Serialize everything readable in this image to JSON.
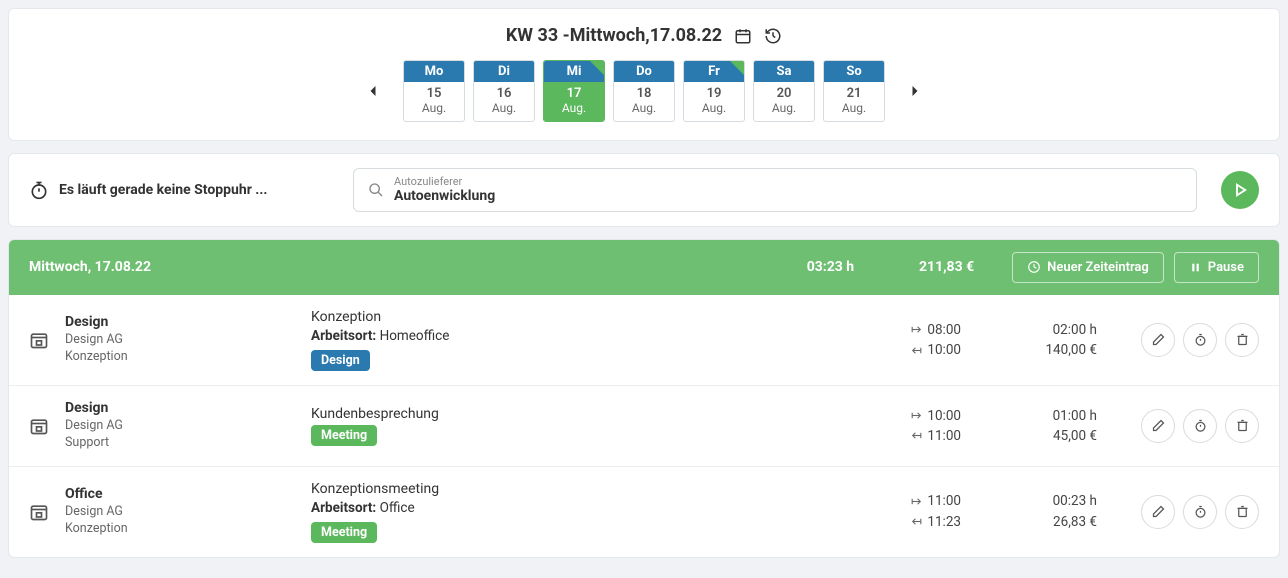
{
  "header": {
    "title": "KW 33 -Mittwoch,17.08.22",
    "days": [
      {
        "dow": "Mo",
        "num": "15",
        "mon": "Aug.",
        "active": false,
        "dot": false
      },
      {
        "dow": "Di",
        "num": "16",
        "mon": "Aug.",
        "active": false,
        "dot": false
      },
      {
        "dow": "Mi",
        "num": "17",
        "mon": "Aug.",
        "active": true,
        "dot": true
      },
      {
        "dow": "Do",
        "num": "18",
        "mon": "Aug.",
        "active": false,
        "dot": false
      },
      {
        "dow": "Fr",
        "num": "19",
        "mon": "Aug.",
        "active": false,
        "dot": true
      },
      {
        "dow": "Sa",
        "num": "20",
        "mon": "Aug.",
        "active": false,
        "dot": false
      },
      {
        "dow": "So",
        "num": "21",
        "mon": "Aug.",
        "active": false,
        "dot": false
      }
    ]
  },
  "stopwatch": {
    "text": "Es läuft gerade keine Stoppuhr ...",
    "search_sup": "Autozulieferer",
    "search_main": "Autoenwicklung"
  },
  "summary": {
    "date": "Mittwoch, 17.08.22",
    "hours": "03:23 h",
    "amount": "211,83 €",
    "new_label": "Neuer Zeiteintrag",
    "pause_label": "Pause"
  },
  "tags": {
    "design": {
      "label": "Design",
      "color": "#2a7ab0"
    },
    "meeting": {
      "label": "Meeting",
      "color": "#5cb85c"
    }
  },
  "work_label": "Arbeitsort:",
  "entries": [
    {
      "title": "Design",
      "org": "Design AG",
      "project": "Konzeption",
      "desc": "Konzeption",
      "workplace": "Homeoffice",
      "tag": "design",
      "start": "08:00",
      "end": "10:00",
      "duration": "02:00 h",
      "amount": "140,00 €"
    },
    {
      "title": "Design",
      "org": "Design AG",
      "project": "Support",
      "desc": "Kundenbesprechung",
      "workplace": "",
      "tag": "meeting",
      "start": "10:00",
      "end": "11:00",
      "duration": "01:00 h",
      "amount": "45,00 €"
    },
    {
      "title": "Office",
      "org": "Design AG",
      "project": "Konzeption",
      "desc": "Konzeptionsmeeting",
      "workplace": "Office",
      "tag": "meeting",
      "start": "11:00",
      "end": "11:23",
      "duration": "00:23 h",
      "amount": "26,83 €"
    }
  ]
}
